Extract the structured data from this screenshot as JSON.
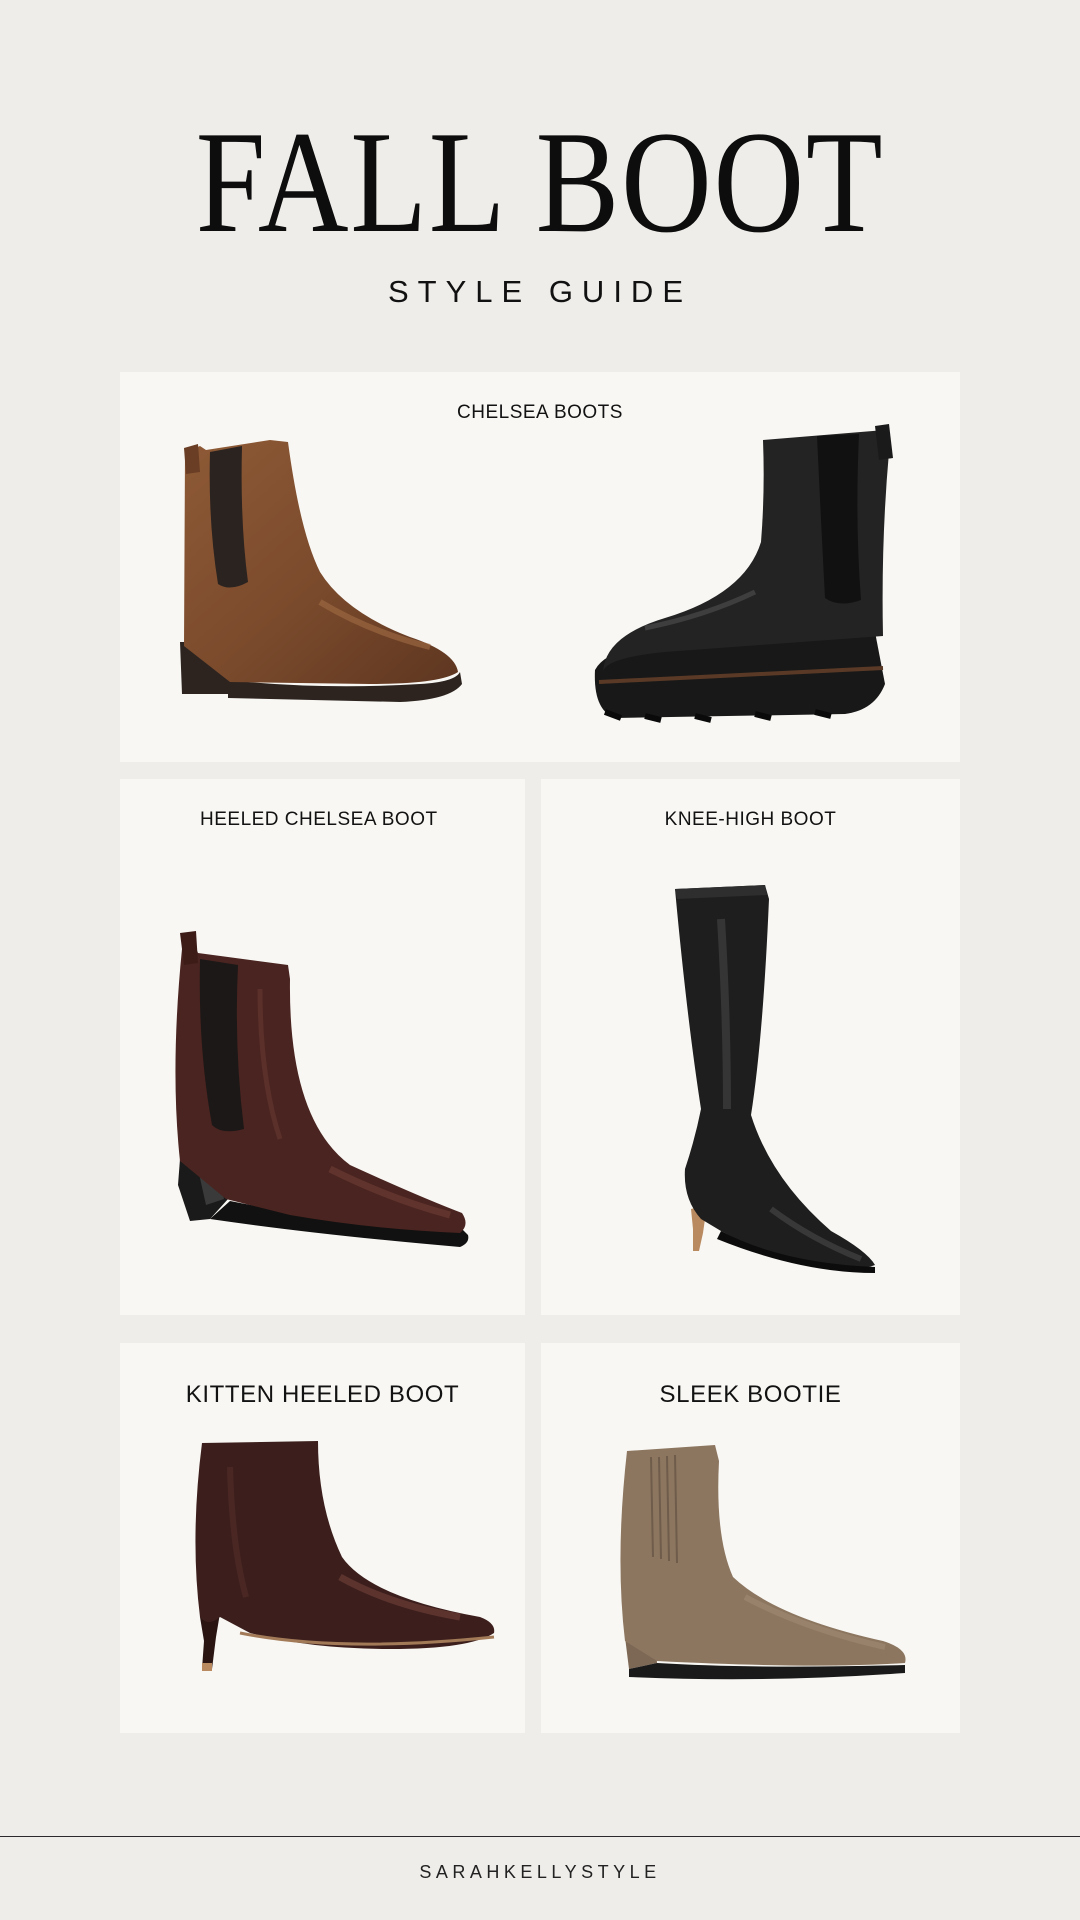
{
  "header": {
    "title": "FALL BOOT",
    "subtitle": "STYLE GUIDE"
  },
  "cards": {
    "chelsea": {
      "label": "CHELSEA BOOTS"
    },
    "heeled_chelsea": {
      "label": "HEELED CHELSEA BOOT"
    },
    "knee_high": {
      "label": "KNEE-HIGH BOOT"
    },
    "kitten_heeled": {
      "label": "KITTEN HEELED BOOT"
    },
    "sleek_bootie": {
      "label": "SLEEK BOOTIE"
    }
  },
  "footer": {
    "brand": "SARAHKELLYSTYLE"
  },
  "colors": {
    "page_background": "#eeede9",
    "card_background": "#f8f7f3",
    "cognac_leather": "#7a4a2c",
    "black_leather": "#1e1e1e",
    "oxblood_leather": "#4a2420",
    "burgundy_leather": "#3c1f1c",
    "taupe_suede": "#8c7660"
  }
}
